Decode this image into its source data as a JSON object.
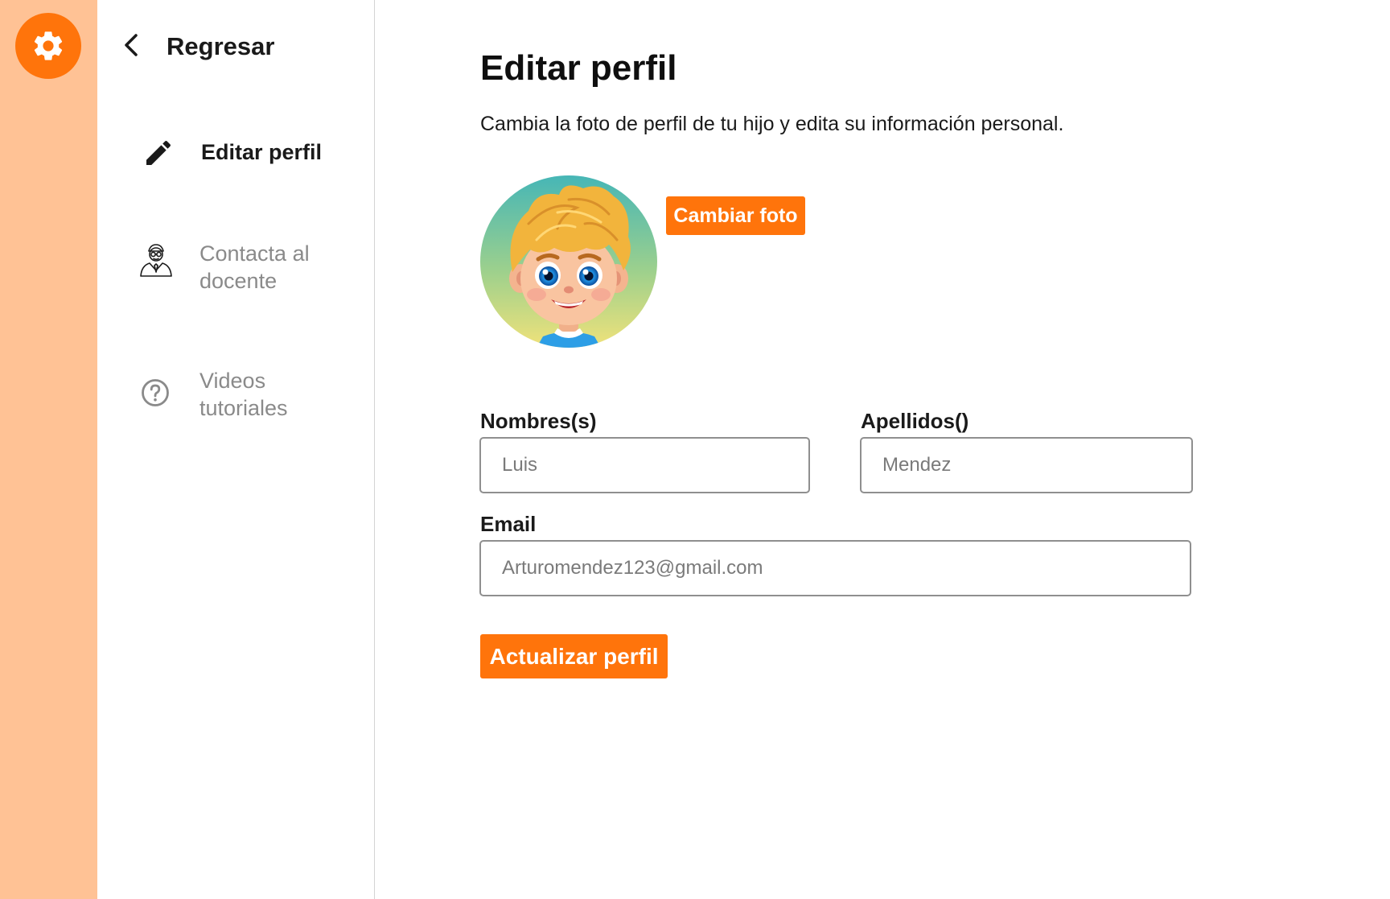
{
  "app": {
    "accent_color": "#ff740b",
    "rail_color": "#ffc295",
    "settings_icon": "gear-icon"
  },
  "sidebar": {
    "back_label": "Regresar",
    "back_icon": "chevron-left-icon",
    "items": [
      {
        "label": "Editar perfil",
        "icon": "pencil-icon",
        "active": true
      },
      {
        "label_line1": "Contacta al",
        "label_line2": "docente",
        "icon": "teacher-icon",
        "active": false
      },
      {
        "label_line1": "Videos",
        "label_line2": "tutoriales",
        "icon": "help-circle-icon",
        "active": false
      }
    ]
  },
  "main": {
    "title": "Editar perfil",
    "subtitle": "Cambia la foto de perfil de tu hijo y edita su información personal.",
    "change_photo_label": "Cambiar foto",
    "form": {
      "first_name_label": "Nombres(s)",
      "first_name_placeholder": "Luis",
      "last_name_label": "Apellidos()",
      "last_name_placeholder": "Mendez",
      "email_label": "Email",
      "email_placeholder": "Arturomendez123@gmail.com"
    },
    "update_button_label": "Actualizar perfil"
  }
}
